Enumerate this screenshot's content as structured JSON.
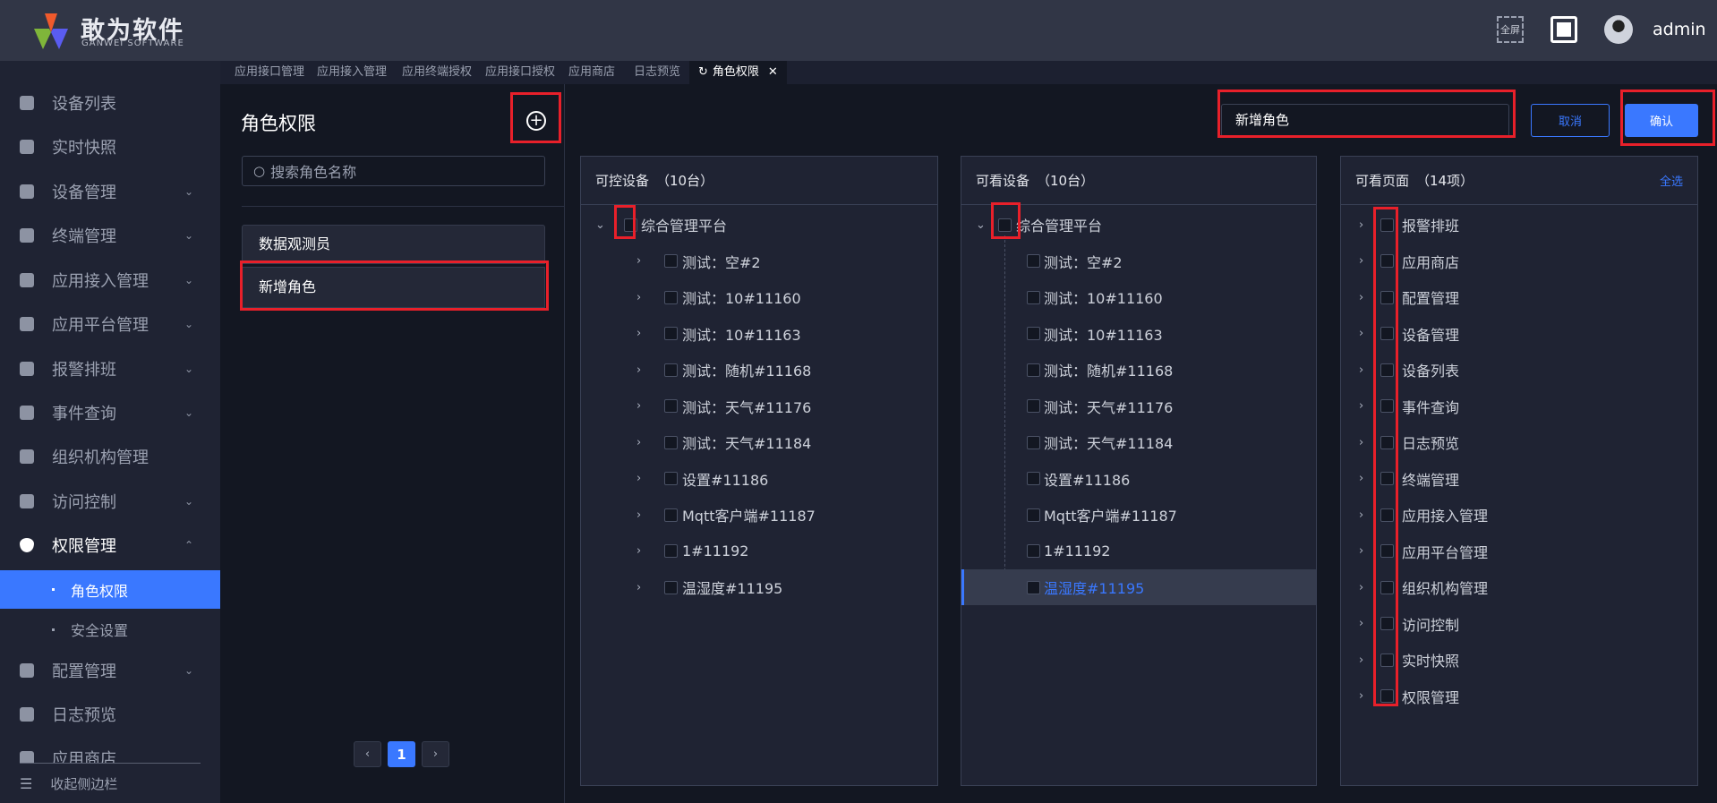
{
  "header": {
    "brand": "敢为软件",
    "brand_sub": "GANWEI SOFTWARE",
    "fullscreen_label": "全屏",
    "user": "admin"
  },
  "tabs": [
    "应用接口管理",
    "应用接入管理",
    "应用终端授权",
    "应用接口授权",
    "应用商店",
    "日志预览",
    "角色权限"
  ],
  "sidebar": {
    "items": [
      {
        "label": "设备列表",
        "chev": false
      },
      {
        "label": "实时快照",
        "chev": false
      },
      {
        "label": "设备管理",
        "chev": true
      },
      {
        "label": "终端管理",
        "chev": true
      },
      {
        "label": "应用接入管理",
        "chev": true
      },
      {
        "label": "应用平台管理",
        "chev": true
      },
      {
        "label": "报警排班",
        "chev": true
      },
      {
        "label": "事件查询",
        "chev": true
      },
      {
        "label": "组织机构管理",
        "chev": false
      },
      {
        "label": "访问控制",
        "chev": true
      },
      {
        "label": "权限管理",
        "chev": true,
        "open": true
      },
      {
        "label": "角色权限",
        "sub": true,
        "active": true
      },
      {
        "label": "安全设置",
        "sub": true
      },
      {
        "label": "配置管理",
        "chev": true
      },
      {
        "label": "日志预览",
        "chev": false
      },
      {
        "label": "应用商店",
        "chev": false
      }
    ],
    "collapse_label": "收起侧边栏"
  },
  "roles": {
    "title": "角色权限",
    "search_placeholder": "搜索角色名称",
    "items": [
      "数据观测员",
      "新增角色"
    ],
    "page": "1"
  },
  "form": {
    "role_name": "新增角色",
    "cancel": "取消",
    "confirm": "确认"
  },
  "colors": {
    "accent": "#3a78ff",
    "highlight": "#e8202a"
  },
  "controllable": {
    "title": "可控设备",
    "count": "（10台）",
    "root": "综合管理平台",
    "children": [
      "测试：空#2",
      "测试：10#11160",
      "测试：10#11163",
      "测试：随机#11168",
      "测试：天气#11176",
      "测试：天气#11184",
      "设置#11186",
      "Mqtt客户端#11187",
      "1#11192",
      "温湿度#11195"
    ]
  },
  "viewable": {
    "title": "可看设备",
    "count": "（10台）",
    "root": "综合管理平台",
    "children": [
      "测试：空#2",
      "测试：10#11160",
      "测试：10#11163",
      "测试：随机#11168",
      "测试：天气#11176",
      "测试：天气#11184",
      "设置#11186",
      "Mqtt客户端#11187",
      "1#11192",
      "温湿度#11195"
    ],
    "selected_index": 9
  },
  "pages": {
    "title": "可看页面",
    "count": "（14项）",
    "select_all": "全选",
    "items": [
      "报警排班",
      "应用商店",
      "配置管理",
      "设备管理",
      "设备列表",
      "事件查询",
      "日志预览",
      "终端管理",
      "应用接入管理",
      "应用平台管理",
      "组织机构管理",
      "访问控制",
      "实时快照",
      "权限管理"
    ]
  }
}
